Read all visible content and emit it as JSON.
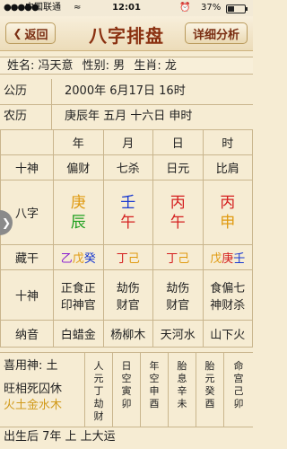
{
  "status_bar": {
    "signal": "●●●●●",
    "carrier": "中国联通",
    "wifi": "≈",
    "time": "12:01",
    "alarm": "⏰",
    "battery_percent": "37%",
    "battery_level": 0.37
  },
  "nav": {
    "back_label": "返回",
    "back_icon": "chevron-left-icon",
    "title": "八字排盘",
    "detail_label": "详细分析"
  },
  "person": {
    "name": "姓名: 冯天意",
    "gender": "性别: 男",
    "zodiac": "生肖: 龙"
  },
  "gongli": {
    "label": "公历",
    "value": "2000年 6月17日 16时"
  },
  "nongli": {
    "label": "农历",
    "value": "庚辰年 五月 十六日 申时"
  },
  "pillars_header": [
    "年",
    "月",
    "日",
    "时"
  ],
  "shishen_top": {
    "label": "十神",
    "values": [
      "偏财",
      "七杀",
      "日元",
      "比肩"
    ]
  },
  "bazi": {
    "label": "八字",
    "stems": [
      "庚",
      "壬",
      "丙",
      "丙"
    ],
    "branches": [
      "辰",
      "午",
      "午",
      "申"
    ]
  },
  "canggan": {
    "label": "藏干",
    "values": [
      [
        "乙",
        "戊",
        "癸"
      ],
      [
        "丁",
        "己"
      ],
      [
        "丁",
        "己"
      ],
      [
        "戊",
        "庚",
        "壬"
      ]
    ]
  },
  "shishen_bottom": {
    "label": "十神",
    "values": [
      [
        "正食正",
        "印神官"
      ],
      [
        "劫伤",
        "财官"
      ],
      [
        "劫伤",
        "财官"
      ],
      [
        "食偏七",
        "神财杀"
      ]
    ]
  },
  "nayin": {
    "label": "纳音",
    "values": [
      "白蜡金",
      "杨柳木",
      "天河水",
      "山下火"
    ]
  },
  "xiyong": "喜用神: 土",
  "wangxiang": {
    "line1": "旺相死囚休",
    "line2": "火土金水木"
  },
  "extra_cols": [
    [
      "人",
      "元",
      "丁",
      "劫",
      "财"
    ],
    [
      "日",
      "空",
      "寅",
      "卯"
    ],
    [
      "年",
      "空",
      "申",
      "酉"
    ],
    [
      "胎",
      "息",
      "辛",
      "未"
    ],
    [
      "胎",
      "元",
      "癸",
      "酉"
    ],
    [
      "命",
      "宫",
      "己",
      "卯"
    ]
  ],
  "dayun": "出生后 7年 上 上大运",
  "side_toggle_icon": "chevron-right-icon"
}
